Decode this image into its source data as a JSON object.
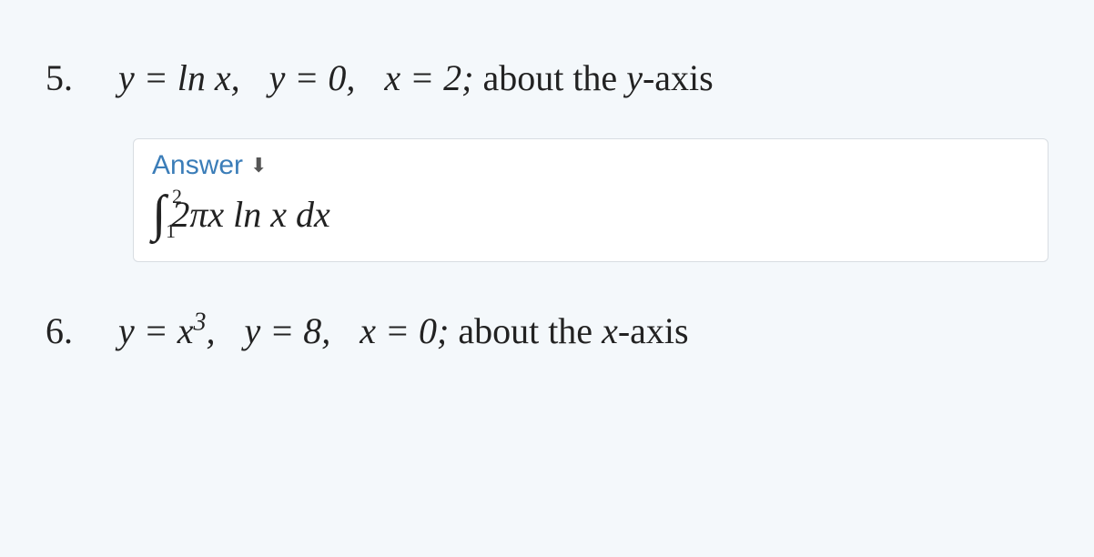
{
  "problems": {
    "p5": {
      "number": "5.",
      "eq_a": "y = ln x,",
      "eq_b": "y = 0,",
      "eq_c": "x = 2;",
      "tail": " about the ",
      "axis": "y",
      "tail2": "-axis"
    },
    "p6": {
      "number": "6.",
      "eq_a_pre": "y = x",
      "eq_a_sup": "3",
      "eq_a_post": ",",
      "eq_b": "y = 8,",
      "eq_c": "x = 0;",
      "tail": " about the ",
      "axis": "x",
      "tail2": "-axis"
    }
  },
  "answer": {
    "label": "Answer",
    "upper": "2",
    "lower": "1",
    "integrand_a": " 2πx ln x dx"
  }
}
